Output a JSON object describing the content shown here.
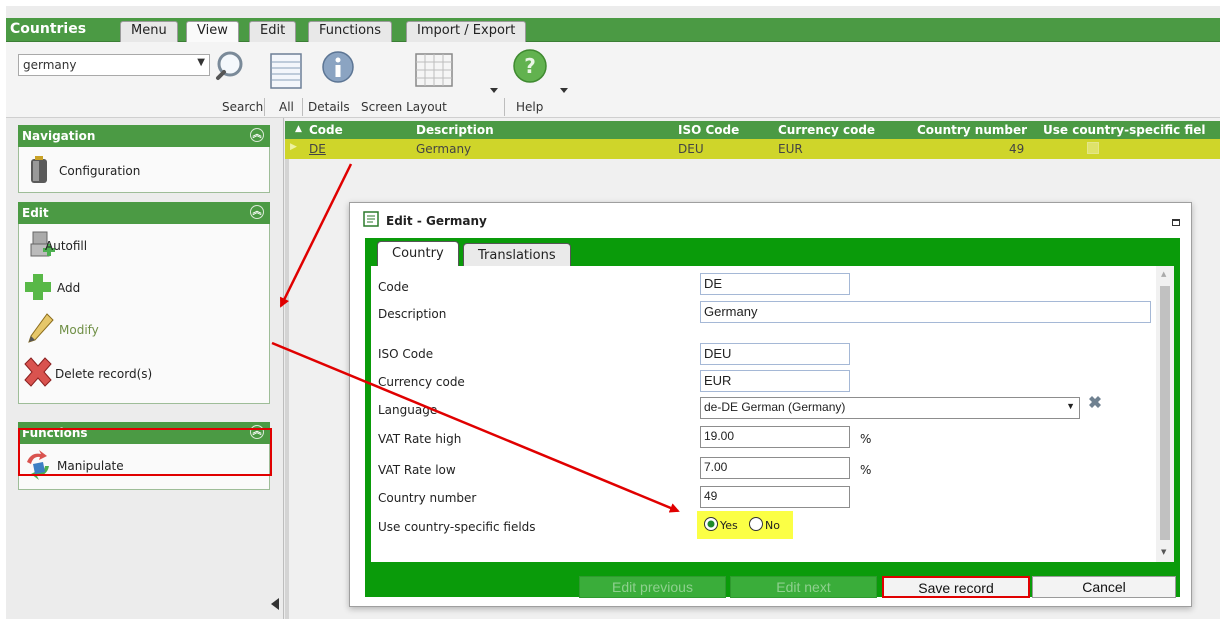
{
  "app": {
    "title": "Countries"
  },
  "tabs": [
    {
      "label": "Menu"
    },
    {
      "label": "View"
    },
    {
      "label": "Edit"
    },
    {
      "label": "Functions"
    },
    {
      "label": "Import / Export"
    }
  ],
  "toolbar": {
    "search_value": "germany",
    "search_label": "Search",
    "all_label": "All",
    "details_label": "Details",
    "screen_layout_label": "Screen Layout",
    "help_label": "Help"
  },
  "sidebar": {
    "navigation": {
      "title": "Navigation",
      "items": [
        {
          "label": "Configuration"
        }
      ]
    },
    "edit": {
      "title": "Edit",
      "items": [
        {
          "label": "Autofill"
        },
        {
          "label": "Add"
        },
        {
          "label": "Modify"
        },
        {
          "label": "Delete record(s)"
        }
      ]
    },
    "functions": {
      "title": "Functions",
      "items": [
        {
          "label": "Manipulate"
        }
      ]
    }
  },
  "grid": {
    "headers": [
      "Code",
      "Description",
      "ISO Code",
      "Currency code",
      "Country number",
      "Use country-specific fiel"
    ],
    "rows": [
      {
        "code": "DE",
        "description": "Germany",
        "iso": "DEU",
        "currency": "EUR",
        "number": "49",
        "specific": true
      }
    ]
  },
  "dialog": {
    "title": "Edit - Germany",
    "tabs": [
      {
        "label": "Country"
      },
      {
        "label": "Translations"
      }
    ],
    "fields": {
      "code": {
        "label": "Code",
        "value": "DE"
      },
      "description": {
        "label": "Description",
        "value": "Germany"
      },
      "iso": {
        "label": "ISO Code",
        "value": "DEU"
      },
      "currency": {
        "label": "Currency code",
        "value": "EUR"
      },
      "language": {
        "label": "Language",
        "value": "de-DE German (Germany)"
      },
      "vat_high": {
        "label": "VAT Rate high",
        "value": "19.00",
        "unit": "%"
      },
      "vat_low": {
        "label": "VAT Rate low",
        "value": "7.00",
        "unit": "%"
      },
      "country_number": {
        "label": "Country number",
        "value": "49"
      },
      "use_specific": {
        "label": "Use country-specific fields",
        "yes": "Yes",
        "no": "No",
        "selected": "Yes"
      }
    },
    "buttons": {
      "prev": "Edit previous",
      "next": "Edit next",
      "save": "Save record",
      "cancel": "Cancel"
    }
  },
  "colors": {
    "brand_green": "#4b9a44",
    "dialog_green": "#0a9b0a",
    "row_highlight": "#cfd52a",
    "annotation_red": "#e00000",
    "radio_highlight": "#fbff45"
  }
}
